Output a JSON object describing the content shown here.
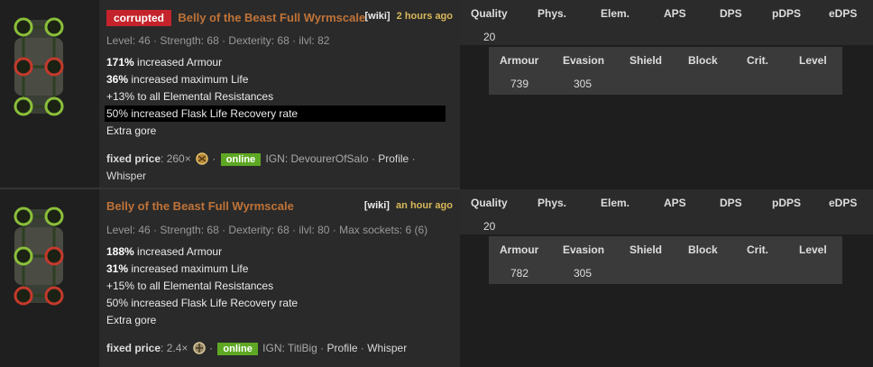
{
  "listings": [
    {
      "corrupted_label": "corrupted",
      "name": "Belly of the Beast Full Wyrmscale",
      "wiki": "[wiki]",
      "age": "2 hours ago",
      "requirements": "Level: 46 · Strength: 68 · Dexterity: 68 · ilvl: 82",
      "mods": [
        {
          "value": "171%",
          "text": " increased Armour"
        },
        {
          "value": "36%",
          "text": " increased maximum Life"
        },
        {
          "value": "",
          "text": "+13% to all Elemental Resistances"
        },
        {
          "value": "",
          "text": "50% increased Flask Life Recovery rate"
        },
        {
          "value": "",
          "text": "Extra gore"
        }
      ],
      "price_label": "fixed price",
      "price_value": ": 260×",
      "currency_icon": "chaos-orb-icon",
      "status": "online",
      "ign": "IGN: DevourerOfSalo ·",
      "profile": "Profile",
      "whisper": "Whisper",
      "properties": {
        "headers": [
          "Quality",
          "Phys.",
          "Elem.",
          "APS",
          "DPS",
          "pDPS",
          "eDPS"
        ],
        "quality": "20",
        "def_headers": [
          "Armour",
          "Evasion",
          "Shield",
          "Block",
          "Crit.",
          "Level"
        ],
        "armour": "739",
        "evasion": "305"
      }
    },
    {
      "name": "Belly of the Beast Full Wyrmscale",
      "wiki": "[wiki]",
      "age": "an hour ago",
      "requirements": "Level: 46 · Strength: 68 · Dexterity: 68 · ilvl: 80 · Max sockets: 6 (6)",
      "mods": [
        {
          "value": "188%",
          "text": " increased Armour"
        },
        {
          "value": "31%",
          "text": " increased maximum Life"
        },
        {
          "value": "",
          "text": "+15% to all Elemental Resistances"
        },
        {
          "value": "",
          "text": "50% increased Flask Life Recovery rate"
        },
        {
          "value": "",
          "text": "Extra gore"
        }
      ],
      "price_label": "fixed price",
      "price_value": ": 2.4×",
      "currency_icon": "exalted-orb-icon",
      "status": "online",
      "ign": "IGN: TitiBig ·",
      "profile": "Profile",
      "whisper": "Whisper",
      "properties": {
        "headers": [
          "Quality",
          "Phys.",
          "Elem.",
          "APS",
          "DPS",
          "pDPS",
          "eDPS"
        ],
        "quality": "20",
        "def_headers": [
          "Armour",
          "Evasion",
          "Shield",
          "Block",
          "Crit.",
          "Level"
        ],
        "armour": "782",
        "evasion": "305"
      }
    }
  ]
}
